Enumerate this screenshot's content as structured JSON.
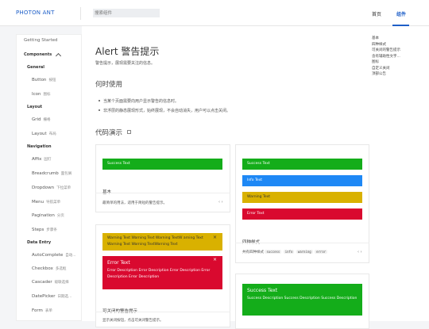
{
  "header": {
    "logo": "PHOTON ANT",
    "search_placeholder": "搜索组件",
    "nav": [
      "首页",
      "组件"
    ]
  },
  "sidebar": {
    "getting_started": "Getting Started",
    "components": "Components",
    "sections": [
      {
        "title": "General",
        "items": [
          {
            "label": "Button",
            "sub": "按钮"
          },
          {
            "label": "Icon",
            "sub": "图标"
          }
        ]
      },
      {
        "title": "Layout",
        "items": [
          {
            "label": "Grid",
            "sub": "栅格"
          },
          {
            "label": "Layout",
            "sub": "布局"
          }
        ]
      },
      {
        "title": "Navigation",
        "items": [
          {
            "label": "Affix",
            "sub": "固钉"
          },
          {
            "label": "Breadcrumb",
            "sub": "面包屑"
          },
          {
            "label": "Dropdown",
            "sub": "下拉菜单"
          },
          {
            "label": "Menu",
            "sub": "导航菜单"
          },
          {
            "label": "Pagination",
            "sub": "分页"
          },
          {
            "label": "Steps",
            "sub": "步骤条"
          }
        ]
      },
      {
        "title": "Data Entry",
        "items": [
          {
            "label": "AutoComplete",
            "sub": "自动..."
          },
          {
            "label": "Checkbox",
            "sub": "多选框"
          },
          {
            "label": "Cascader",
            "sub": "级联选择"
          },
          {
            "label": "DatePicker",
            "sub": "日期选..."
          },
          {
            "label": "Form",
            "sub": "表单"
          }
        ]
      }
    ]
  },
  "page": {
    "title": "Alert 警告提示",
    "description": "警告提示，展现需要关注的信息。",
    "when_title": "何时使用",
    "when_items": [
      "当某个页面需要向用户显示警告的信息时。",
      "非浮层的静态展现形式，始终展现，不会自动消失，用户可以点击关闭。"
    ],
    "demo_title": "代码演示"
  },
  "toc": [
    "基本",
    "四种样式",
    "可关闭的警告提示",
    "含有辅助性文字...",
    "图标",
    "自定义关闭",
    "顶部公告"
  ],
  "demos": {
    "basic": {
      "alert": "Success Text",
      "label": "基本",
      "desc": "最简单的用法，适用于简短的警告提示。"
    },
    "closable": {
      "warning": "Warning Text Warning Text Warning TextW arning Text Warning Text Warning TextWarning Text",
      "error_title": "Error Text",
      "error_desc": "Error Description Error Description Error Description Error Description Error Description",
      "label": "可关闭的警告提示",
      "desc": "显示关闭按钮，点击可关闭警告提示。"
    },
    "styles": {
      "alerts": [
        "Success Text",
        "Info Text",
        "Warning Text",
        "Error Text"
      ],
      "label": "四种样式",
      "desc_prefix": "共有四种样式",
      "tags": [
        "success",
        "info",
        "warning",
        "error"
      ]
    },
    "description": {
      "title": "Success Text",
      "desc": "Success Description Success Description Success Description"
    }
  },
  "icons": {
    "code": "code-icon",
    "close": "close-icon"
  },
  "colors": {
    "primary": "#1e5fc8",
    "success": "#14ad1a",
    "info": "#1e88f5",
    "warning": "#d9b100",
    "error": "#d9092f"
  }
}
